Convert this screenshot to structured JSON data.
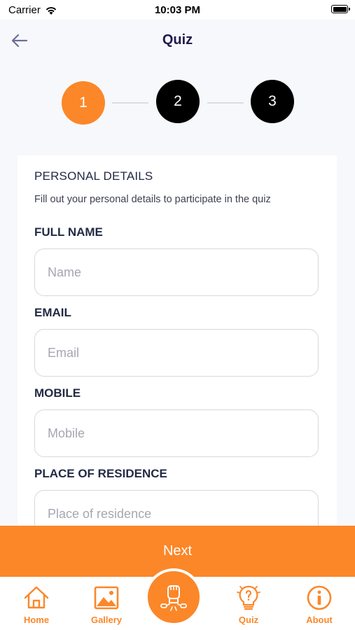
{
  "status_bar": {
    "carrier": "Carrier",
    "time": "10:03 PM"
  },
  "header": {
    "title": "Quiz"
  },
  "stepper": {
    "steps": [
      "1",
      "2",
      "3"
    ],
    "active_step": 1
  },
  "form": {
    "section_title": "PERSONAL DETAILS",
    "section_subtitle": "Fill out your personal details to participate in the quiz",
    "fields": [
      {
        "label": "FULL NAME",
        "placeholder": "Name",
        "value": ""
      },
      {
        "label": "EMAIL",
        "placeholder": "Email",
        "value": ""
      },
      {
        "label": "MOBILE",
        "placeholder": "Mobile",
        "value": ""
      },
      {
        "label": "PLACE OF RESIDENCE",
        "placeholder": "Place of residence",
        "value": ""
      }
    ]
  },
  "next_button": {
    "label": "Next"
  },
  "tab_bar": {
    "items": [
      {
        "label": "Home",
        "icon": "home-icon"
      },
      {
        "label": "Gallery",
        "icon": "gallery-icon"
      },
      {
        "label": "",
        "icon": "raised-fist-broken-chain-icon"
      },
      {
        "label": "Quiz",
        "icon": "lightbulb-question-icon"
      },
      {
        "label": "About",
        "icon": "info-icon"
      }
    ]
  },
  "colors": {
    "accent": "#fb8729",
    "title": "#1f1b4d",
    "step_inactive": "#000000",
    "background": "#f7f8fc"
  }
}
